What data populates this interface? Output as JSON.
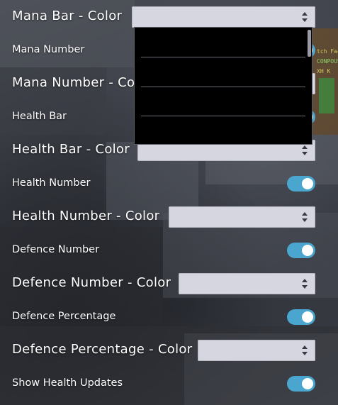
{
  "settings": [
    {
      "id": "mana-bar-color",
      "type": "select",
      "label": "Mana Bar - Color",
      "value": ""
    },
    {
      "id": "mana-number",
      "type": "toggle",
      "label": "Mana Number",
      "enabled": true
    },
    {
      "id": "mana-number-color",
      "type": "select",
      "label": "Mana Number - Color",
      "value": ""
    },
    {
      "id": "health-bar",
      "type": "toggle",
      "label": "Health Bar",
      "enabled": true
    },
    {
      "id": "health-bar-color",
      "type": "select",
      "label": "Health Bar - Color",
      "value": ""
    },
    {
      "id": "health-number",
      "type": "toggle",
      "label": "Health Number",
      "enabled": true
    },
    {
      "id": "health-number-color",
      "type": "select",
      "label": "Health Number - Color",
      "value": ""
    },
    {
      "id": "defence-number",
      "type": "toggle",
      "label": "Defence Number",
      "enabled": true
    },
    {
      "id": "defence-number-color",
      "type": "select",
      "label": "Defence Number - Color",
      "value": ""
    },
    {
      "id": "defence-percentage",
      "type": "toggle",
      "label": "Defence Percentage",
      "enabled": true
    },
    {
      "id": "defence-percentage-color",
      "type": "select",
      "label": "Defence Percentage - Color",
      "value": ""
    },
    {
      "id": "show-health-updates",
      "type": "toggle",
      "label": "Show Health Updates",
      "enabled": true
    }
  ],
  "dropdown": {
    "open_for": "Mana Bar - Color",
    "options": [
      "",
      "",
      "",
      ""
    ]
  },
  "background_hud": {
    "line1": "tch Fac",
    "line2": "CONPOUS",
    "line3": "XH K"
  },
  "colors": {
    "toggle_on": "#4aa6cf",
    "select_bg": "#d6d6e0",
    "dropdown_bg": "#000000"
  },
  "icons": {
    "select_arrows": "up-down-arrows-icon",
    "toggle_knob": "toggle-knob"
  }
}
